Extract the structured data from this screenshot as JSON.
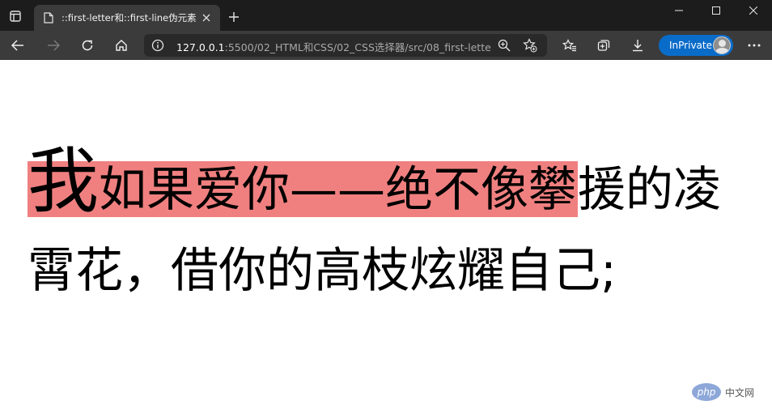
{
  "browser": {
    "tab": {
      "title": "::first-letter和::first-line伪元素"
    },
    "address": {
      "host": "127.0.0.1",
      "path": ":5500/02_HTML和CSS/02_CSS选择器/src/08_first-lette..."
    },
    "inprivate_label": "InPrivate",
    "accent_color": "#0a6cc9"
  },
  "page": {
    "first_letter": "我",
    "first_line_rest": "如果爱你——绝不像攀",
    "remaining_text": "援的凌霄花，借你的高枝炫耀自己;",
    "highlight_color": "#f08080"
  },
  "watermark": {
    "logo": "php",
    "text": "中文网"
  }
}
